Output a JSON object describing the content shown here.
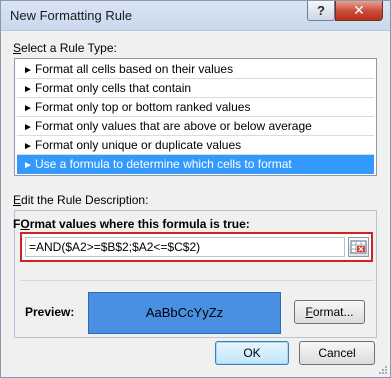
{
  "window": {
    "title": "New Formatting Rule",
    "help_label": "?",
    "close_label": "✕"
  },
  "rule_type": {
    "label_underlined": "S",
    "label_rest": "elect a Rule Type:",
    "items": [
      "Format all cells based on their values",
      "Format only cells that contain",
      "Format only top or bottom ranked values",
      "Format only values that are above or below average",
      "Format only unique or duplicate values",
      "Use a formula to determine which cells to format"
    ],
    "selected_index": 5,
    "arrow": "►"
  },
  "description": {
    "label_underlined": "E",
    "label_rest": "dit the Rule Description:",
    "format_label_underlined": "O",
    "format_label_pre": "F",
    "format_label_rest": "rmat values where this formula is true:",
    "formula_value": "=AND($A2>=$B$2;$A2<=$C$2)"
  },
  "preview": {
    "label": "Preview:",
    "sample_text": "AaBbCcYyZz",
    "fill_color": "#4a90e2"
  },
  "buttons": {
    "format_underlined": "F",
    "format_rest": "ormat...",
    "ok": "OK",
    "cancel": "Cancel"
  },
  "colors": {
    "selection": "#3399ff",
    "highlight_border": "#d32222"
  }
}
